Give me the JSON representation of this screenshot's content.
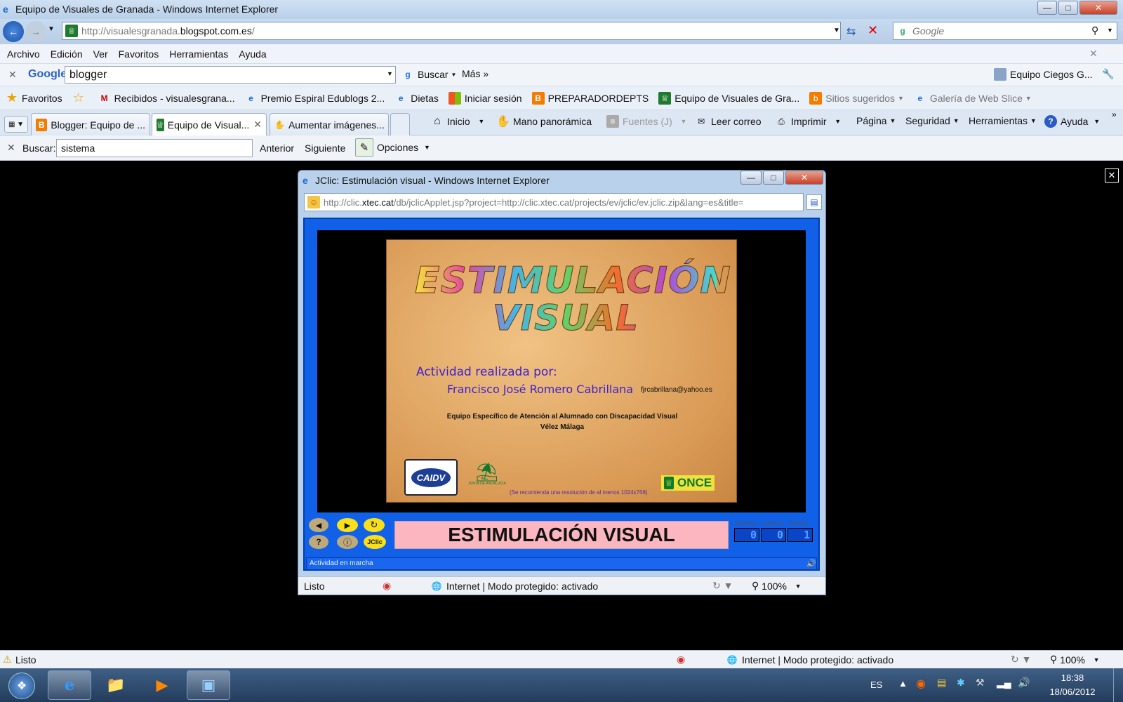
{
  "window": {
    "title": "Equipo de Visuales de Granada - Windows Internet Explorer"
  },
  "address": {
    "url_prefix": "http://visualesgranada.",
    "url_domain": "blogspot.com.es",
    "url_suffix": "/",
    "search_placeholder": "Google"
  },
  "menu": [
    "Archivo",
    "Edición",
    "Ver",
    "Favoritos",
    "Herramientas",
    "Ayuda"
  ],
  "google_bar": {
    "logo": "Google",
    "query": "blogger",
    "search_label": "Buscar",
    "more_label": "Más",
    "account_label": "Equipo Ciegos G..."
  },
  "favorites": {
    "label": "Favoritos",
    "items": [
      "Recibidos - visualesgrana...",
      "Premio Espiral Edublogs 2...",
      "Dietas",
      "Iniciar sesión",
      "PREPARADORDEPTS",
      "Equipo de Visuales de Gra...",
      "Sitios sugeridos",
      "Galería de Web Slice"
    ]
  },
  "tabs": [
    {
      "label": "Blogger: Equipo de ..."
    },
    {
      "label": "Equipo de Visual..."
    },
    {
      "label": "Aumentar imágenes..."
    }
  ],
  "commands": [
    "Inicio",
    "Mano panorámica",
    "Fuentes (J)",
    "Leer correo",
    "Imprimir",
    "Página",
    "Seguridad",
    "Herramientas",
    "Ayuda"
  ],
  "find_bar": {
    "label": "Buscar:",
    "value": "sistema",
    "prev": "Anterior",
    "next": "Siguiente",
    "options": "Opciones"
  },
  "popup": {
    "title": "JClic: Estimulación visual - Windows Internet Explorer",
    "url_prefix": "http://clic.",
    "url_domain": "xtec.cat",
    "url_suffix": "/db/jclicApplet.jsp?project=http://clic.xtec.cat/projects/ev/jclic/ev.jclic.zip&lang=es&title=",
    "status": "Listo",
    "zone": "Internet | Modo protegido: activado",
    "zoom": "100%"
  },
  "jclic": {
    "title_line1": "ESTIMULACIÓN",
    "title_line2": "VISUAL",
    "credit_label": "Actividad realizada por:",
    "author": "Francisco José Romero Cabrillana",
    "email": "fjrcabrillana@yahoo.es",
    "team": "Equipo Específico de Atención al Alumnado con Discapacidad Visual",
    "city": "Vélez Málaga",
    "recommend": "(Se recomienda una resolución de al menos 1024x768)",
    "logo_caidv": "CAIDV",
    "logo_junta": "JUNTA DE ANDALUCIA",
    "logo_once": "ONCE",
    "message": "ESTIMULACIÓN VISUAL",
    "counters": [
      {
        "label": "aciertos",
        "value": "0"
      },
      {
        "label": "intentos",
        "value": "0"
      },
      {
        "label": "tiempo",
        "value": "1"
      }
    ],
    "status": "Actividad en marcha",
    "jclic_btn": "JClic"
  },
  "status": {
    "text": "Listo",
    "zone": "Internet | Modo protegido: activado",
    "zoom": "100%"
  },
  "taskbar": {
    "lang": "ES",
    "time": "18:38",
    "date": "18/06/2012"
  },
  "colors": {
    "jclic_blue": "#1060e8",
    "message_bg": "#fbb6c0",
    "credit_text": "#3d1fd2"
  }
}
